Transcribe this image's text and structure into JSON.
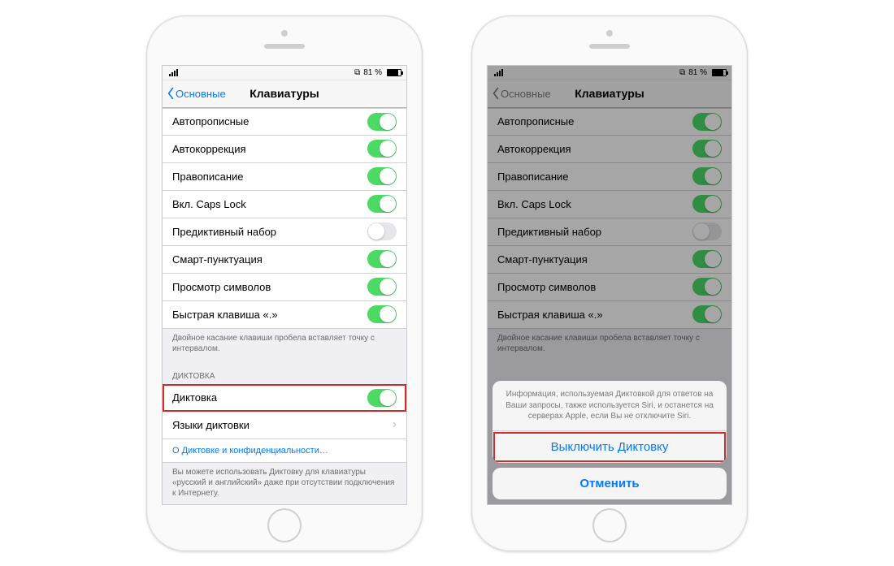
{
  "status": {
    "battery_pct": "81 %",
    "battery_fill": 81
  },
  "nav": {
    "back": "Основные",
    "title": "Клавиатуры"
  },
  "settings": [
    {
      "label": "Автопрописные",
      "on": true
    },
    {
      "label": "Автокоррекция",
      "on": true
    },
    {
      "label": "Правописание",
      "on": true
    },
    {
      "label": "Вкл. Caps Lock",
      "on": true
    },
    {
      "label": "Предиктивный набор",
      "on": false
    },
    {
      "label": "Смарт-пунктуация",
      "on": true
    },
    {
      "label": "Просмотр символов",
      "on": true
    },
    {
      "label": "Быстрая клавиша «.»",
      "on": true
    }
  ],
  "settings_footer": "Двойное касание клавиши пробела вставляет точку с интервалом.",
  "dictation_header": "ДИКТОВКА",
  "dictation_row": {
    "label": "Диктовка",
    "on": true
  },
  "dictation_lang_row": "Языки диктовки",
  "dictation_link": "О Диктовке и конфиденциальности…",
  "dictation_footer": "Вы можете использовать Диктовку для клавиатуры «русский и английский» даже при отсутствии подключения к Интернету.",
  "sheet": {
    "message": "Информация, используемая Диктовкой для ответов на Ваши запросы, также используется Siri, и останется на серверах Apple, если Вы не отключите Siri.",
    "destructive": "Выключить Диктовку",
    "cancel": "Отменить"
  }
}
